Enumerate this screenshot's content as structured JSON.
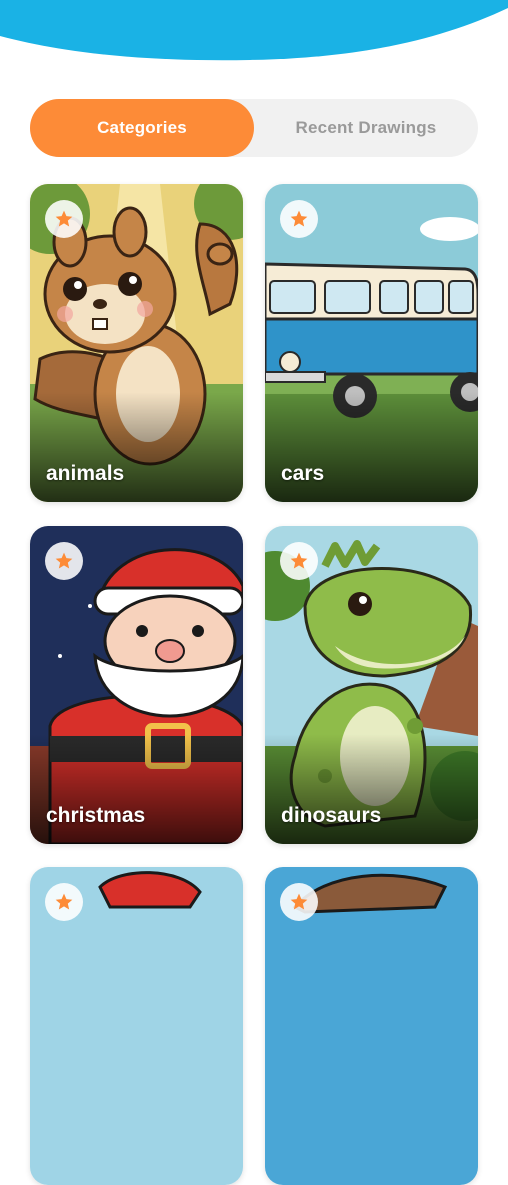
{
  "colors": {
    "header_blue": "#1ab2e5",
    "accent_orange": "#fd8b37",
    "tab_inactive_bg": "#f1f1f1",
    "tab_inactive_text": "#9a9a9a"
  },
  "tabs": {
    "categories_label": "Categories",
    "recent_label": "Recent Drawings",
    "selected": "Categories"
  },
  "categories": [
    {
      "label": "animals",
      "icon": "star-icon"
    },
    {
      "label": "cars",
      "icon": "star-icon"
    },
    {
      "label": "christmas",
      "icon": "star-icon"
    },
    {
      "label": "dinosaurs",
      "icon": "star-icon"
    }
  ]
}
